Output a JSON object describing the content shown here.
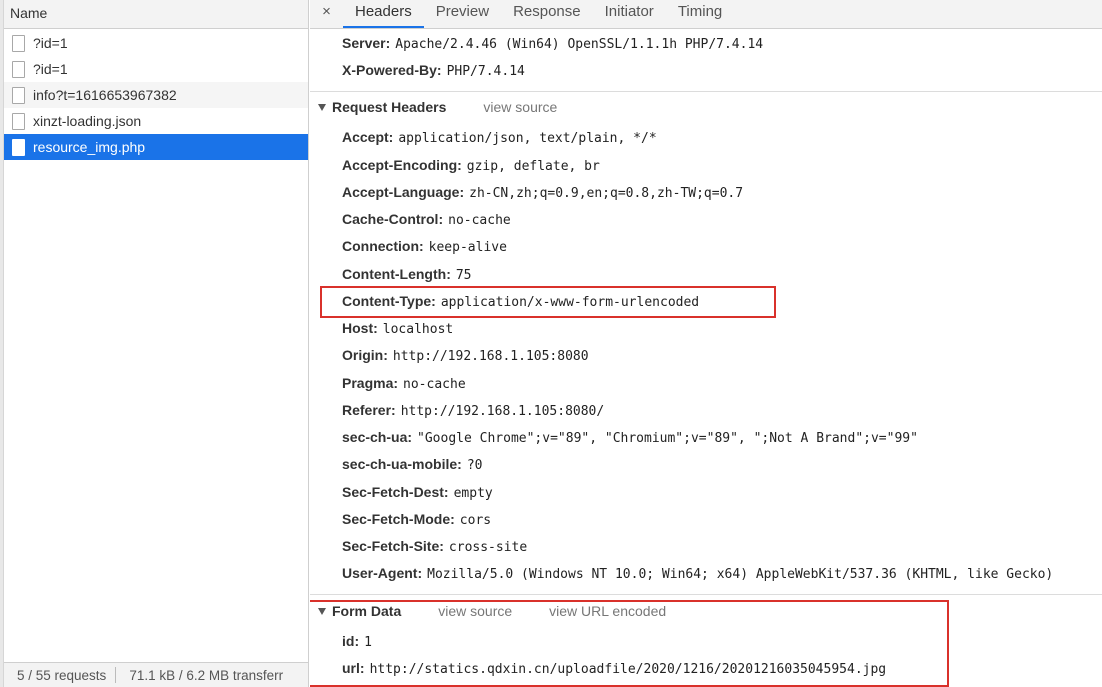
{
  "left_panel": {
    "column_header": "Name",
    "requests": [
      {
        "name": "?id=1",
        "selected": false
      },
      {
        "name": "?id=1",
        "selected": false
      },
      {
        "name": "info?t=1616653967382",
        "selected": false
      },
      {
        "name": "xinzt-loading.json",
        "selected": false
      },
      {
        "name": "resource_img.php",
        "selected": true
      }
    ],
    "status_requests": "5 / 55 requests",
    "status_transfer": "71.1 kB / 6.2 MB transferr"
  },
  "tabs": {
    "close_glyph": "×",
    "items": [
      "Headers",
      "Preview",
      "Response",
      "Initiator",
      "Timing"
    ],
    "active": "Headers"
  },
  "response_headers_tail": [
    {
      "key": "Server:",
      "value": "Apache/2.4.46 (Win64) OpenSSL/1.1.1h PHP/7.4.14"
    },
    {
      "key": "X-Powered-By:",
      "value": "PHP/7.4.14"
    }
  ],
  "request_headers": {
    "title": "Request Headers",
    "view_source": "view source",
    "rows": [
      {
        "key": "Accept:",
        "value": "application/json, text/plain, */*"
      },
      {
        "key": "Accept-Encoding:",
        "value": "gzip, deflate, br"
      },
      {
        "key": "Accept-Language:",
        "value": "zh-CN,zh;q=0.9,en;q=0.8,zh-TW;q=0.7"
      },
      {
        "key": "Cache-Control:",
        "value": "no-cache"
      },
      {
        "key": "Connection:",
        "value": "keep-alive"
      },
      {
        "key": "Content-Length:",
        "value": "75"
      },
      {
        "key": "Content-Type:",
        "value": "application/x-www-form-urlencoded"
      },
      {
        "key": "Host:",
        "value": "localhost"
      },
      {
        "key": "Origin:",
        "value": "http://192.168.1.105:8080"
      },
      {
        "key": "Pragma:",
        "value": "no-cache"
      },
      {
        "key": "Referer:",
        "value": "http://192.168.1.105:8080/"
      },
      {
        "key": "sec-ch-ua:",
        "value": "\"Google Chrome\";v=\"89\", \"Chromium\";v=\"89\", \";Not A Brand\";v=\"99\""
      },
      {
        "key": "sec-ch-ua-mobile:",
        "value": "?0"
      },
      {
        "key": "Sec-Fetch-Dest:",
        "value": "empty"
      },
      {
        "key": "Sec-Fetch-Mode:",
        "value": "cors"
      },
      {
        "key": "Sec-Fetch-Site:",
        "value": "cross-site"
      },
      {
        "key": "User-Agent:",
        "value": "Mozilla/5.0 (Windows NT 10.0; Win64; x64) AppleWebKit/537.36 (KHTML, like Gecko)"
      }
    ]
  },
  "form_data": {
    "title": "Form Data",
    "view_source": "view source",
    "view_url_encoded": "view URL encoded",
    "rows": [
      {
        "key": "id:",
        "value": "1"
      },
      {
        "key": "url:",
        "value": "http://statics.qdxin.cn/uploadfile/2020/1216/20201216035045954.jpg"
      }
    ]
  },
  "colors": {
    "selection": "#1a73e8",
    "highlight_box": "#d9312b"
  }
}
